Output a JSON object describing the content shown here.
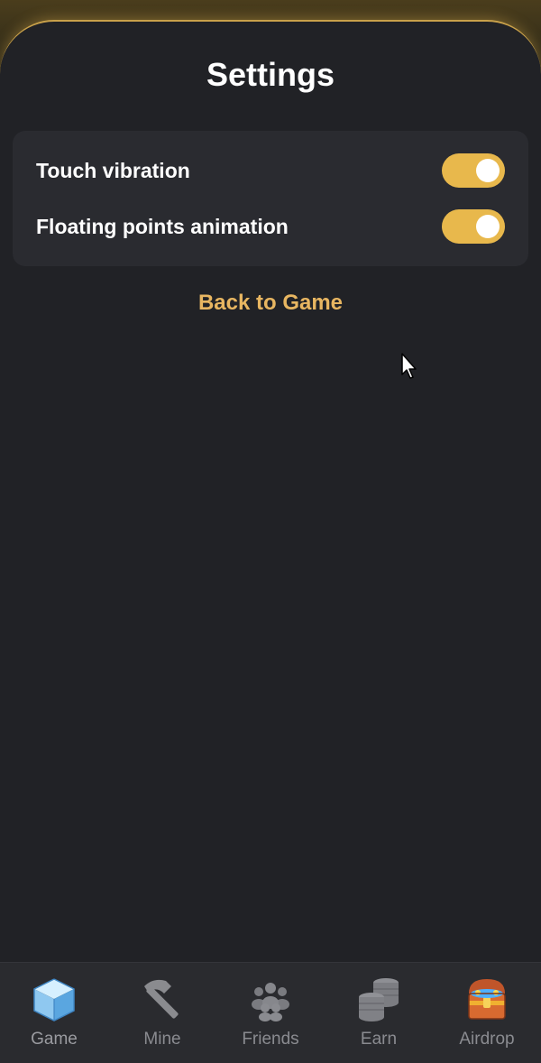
{
  "header": {
    "title": "Settings"
  },
  "settings": {
    "items": [
      {
        "label": "Touch vibration",
        "enabled": true
      },
      {
        "label": "Floating points animation",
        "enabled": true
      }
    ]
  },
  "back_link": "Back to Game",
  "nav": {
    "items": [
      {
        "label": "Game",
        "icon": "cube-icon",
        "active": true
      },
      {
        "label": "Mine",
        "icon": "pickaxe-icon",
        "active": false
      },
      {
        "label": "Friends",
        "icon": "friends-icon",
        "active": false
      },
      {
        "label": "Earn",
        "icon": "coins-icon",
        "active": false
      },
      {
        "label": "Airdrop",
        "icon": "treasure-chest-icon",
        "active": false
      }
    ]
  },
  "colors": {
    "accent": "#e8b84c",
    "background": "#212226",
    "panel": "#2a2b30",
    "link": "#e8b661"
  }
}
